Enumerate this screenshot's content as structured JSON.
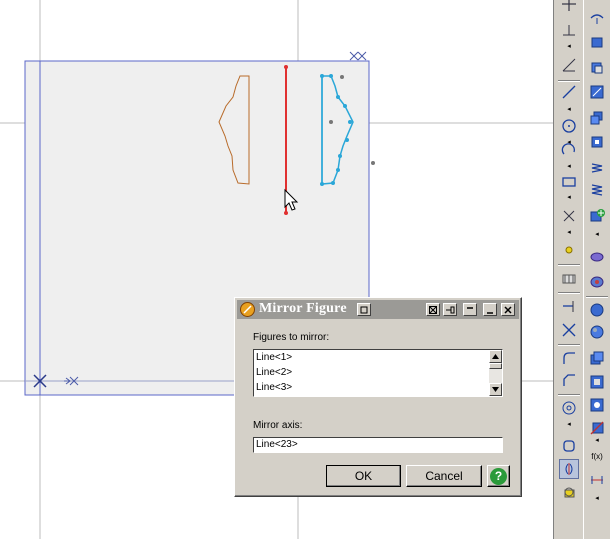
{
  "dialog": {
    "title": "Mirror Figure",
    "figures_label": "Figures to mirror:",
    "figures": [
      "Line<1>",
      "Line<2>",
      "Line<3>"
    ],
    "axis_label": "Mirror axis:",
    "axis_value": "Line<23>",
    "ok_label": "OK",
    "cancel_label": "Cancel",
    "help_label": "?"
  },
  "toolbar1": {
    "fx_label": "f(x)"
  },
  "colors": {
    "canvas": "#ffffff",
    "sheet": "#efefef",
    "sheet_border": "#5b67c8",
    "profile_original": "#b86b2a",
    "profile_mirrored": "#2aa7d8",
    "mirror_axis": "#e03030",
    "dialog_bg": "#d4d0c8",
    "titlebar": "#9b9a96"
  },
  "icons": {
    "dialog_app": "app-logo-icon",
    "cursor": "mouse-pointer-icon"
  }
}
